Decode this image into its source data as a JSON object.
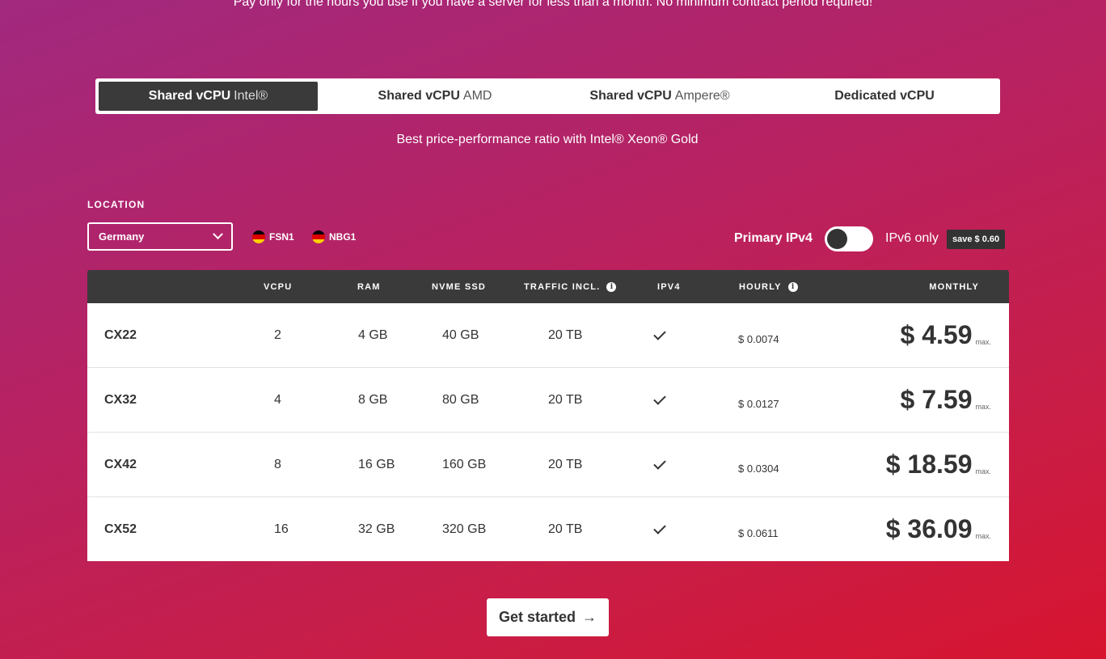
{
  "top_note": "Pay only for the hours you use if you have a server for less than a month. No minimum contract period required!",
  "tabs": [
    {
      "label": "Shared vCPU",
      "sub": "Intel®",
      "active": true
    },
    {
      "label": "Shared vCPU",
      "sub": "AMD",
      "active": false
    },
    {
      "label": "Shared vCPU",
      "sub": "Ampere®",
      "active": false
    },
    {
      "label": "Dedicated vCPU",
      "sub": "",
      "active": false
    }
  ],
  "tab_description": "Best price-performance ratio with Intel® Xeon® Gold",
  "location": {
    "label": "LOCATION",
    "selected": "Germany",
    "datacenters": [
      "FSN1",
      "NBG1"
    ]
  },
  "network": {
    "primary_ipv4_label": "Primary IPv4",
    "ipv6_label": "IPv6 only",
    "save_badge": "save $ 0.60",
    "toggle_on": false
  },
  "table": {
    "headers": {
      "vcpu": "VCPU",
      "ram": "RAM",
      "ssd": "NVME SSD",
      "traffic": "TRAFFIC INCL.",
      "ipv4": "IPV4",
      "hourly": "HOURLY",
      "monthly": "MONTHLY"
    },
    "rows": [
      {
        "name": "CX22",
        "vcpu": "2",
        "ram": "4 GB",
        "ssd": "40 GB",
        "traffic": "20 TB",
        "ipv4": true,
        "hourly": "$ 0.0074",
        "monthly": "$ 4.59",
        "max": "max."
      },
      {
        "name": "CX32",
        "vcpu": "4",
        "ram": "8 GB",
        "ssd": "80 GB",
        "traffic": "20 TB",
        "ipv4": true,
        "hourly": "$ 0.0127",
        "monthly": "$ 7.59",
        "max": "max."
      },
      {
        "name": "CX42",
        "vcpu": "8",
        "ram": "16 GB",
        "ssd": "160 GB",
        "traffic": "20 TB",
        "ipv4": true,
        "hourly": "$ 0.0304",
        "monthly": "$ 18.59",
        "max": "max."
      },
      {
        "name": "CX52",
        "vcpu": "16",
        "ram": "32 GB",
        "ssd": "320 GB",
        "traffic": "20 TB",
        "ipv4": true,
        "hourly": "$ 0.0611",
        "monthly": "$ 36.09",
        "max": "max."
      }
    ]
  },
  "cta": {
    "label": "Get started"
  },
  "colors": {
    "dark": "#3a3a3a",
    "gradient_start": "#a1297f",
    "gradient_end": "#d7142f"
  }
}
